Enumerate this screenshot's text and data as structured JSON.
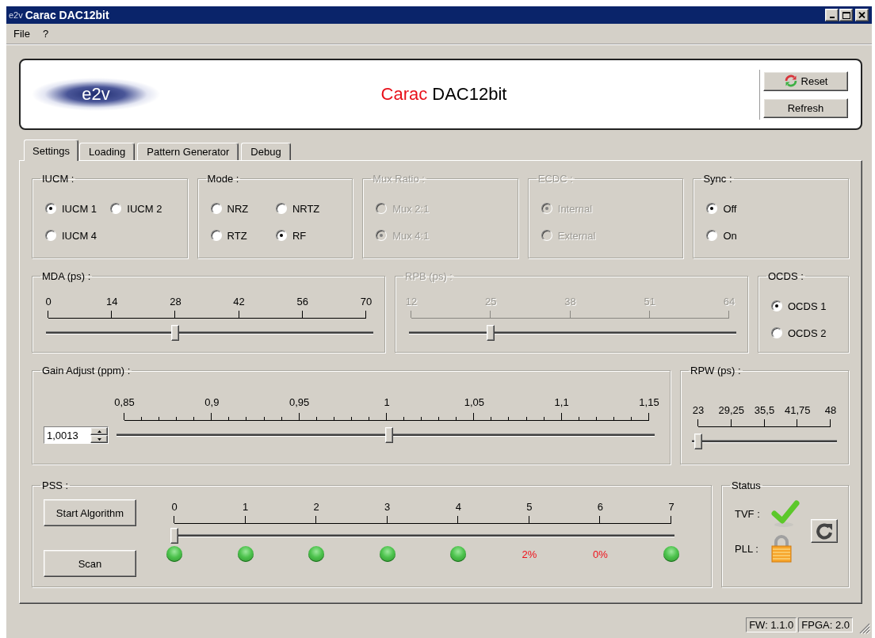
{
  "window": {
    "icon_label": "e2v",
    "title": "Carac DAC12bit"
  },
  "menu": [
    {
      "label": "File"
    },
    {
      "label": "?"
    }
  ],
  "header": {
    "logo": "e2v",
    "title_accent": "Carac",
    "title": "DAC12bit",
    "buttons": [
      {
        "label": "Reset",
        "kind": "reset"
      },
      {
        "label": "Refresh",
        "kind": "plain"
      }
    ]
  },
  "tabs": [
    {
      "label": "Settings",
      "selected": true
    },
    {
      "label": "Loading",
      "selected": false
    },
    {
      "label": "Pattern Generator",
      "selected": false
    },
    {
      "label": "Debug",
      "selected": false
    }
  ],
  "rows": [
    {
      "panels": [
        {
          "kind": "radios",
          "title": "IUCM :",
          "disabled": false,
          "options": [
            {
              "label": "IUCM 1",
              "selected": true
            },
            {
              "label": "IUCM 2",
              "selected": false
            },
            {
              "label": "IUCM 4",
              "selected": false
            }
          ]
        },
        {
          "kind": "radios",
          "title": "Mode :",
          "disabled": false,
          "options": [
            {
              "label": "NRZ",
              "selected": false
            },
            {
              "label": "NRTZ",
              "selected": false
            },
            {
              "label": "RTZ",
              "selected": false
            },
            {
              "label": "RF",
              "selected": true
            }
          ]
        },
        {
          "kind": "radios",
          "title": "Mux Ratio :",
          "disabled": true,
          "options": [
            {
              "label": "Mux 2:1",
              "selected": false
            },
            {
              "label": "Mux 4:1",
              "selected": true
            }
          ]
        },
        {
          "kind": "radios",
          "title": "ECDC :",
          "disabled": true,
          "options": [
            {
              "label": "Internal",
              "selected": true
            },
            {
              "label": "External",
              "selected": false
            }
          ]
        },
        {
          "kind": "radios",
          "title": "Sync :",
          "disabled": false,
          "options": [
            {
              "label": "Off",
              "selected": true
            },
            {
              "label": "On",
              "selected": false
            }
          ]
        }
      ]
    },
    {
      "panels": [
        {
          "kind": "slider",
          "title": "MDA (ps) :",
          "disabled": false,
          "ticks": [
            "0",
            "14",
            "28",
            "42",
            "56",
            "70"
          ],
          "level": 0.4
        },
        {
          "kind": "slider",
          "title": "RPB (ps) :",
          "disabled": true,
          "ticks": [
            "12",
            "25",
            "38",
            "51",
            "64"
          ],
          "level": 0.25
        },
        {
          "kind": "radios",
          "title": "OCDS :",
          "disabled": false,
          "options": [
            {
              "label": "OCDS 1",
              "selected": true
            },
            {
              "label": "OCDS 2",
              "selected": false
            }
          ]
        }
      ]
    },
    {
      "panels": [
        {
          "kind": "spinslider",
          "title": "Gain Adjust (ppm) :",
          "disabled": false,
          "ticks": [
            "0,85",
            "0,9",
            "0,95",
            "1",
            "1,05",
            "1,1",
            "1,15"
          ],
          "level": 0.504,
          "spin_value": "1,0013"
        },
        {
          "kind": "narrowslider",
          "title": "RPW (ps) :",
          "disabled": false,
          "ticks": [
            "23",
            "29,25",
            "35,5",
            "41,75",
            "48"
          ],
          "level": 0
        }
      ]
    },
    {
      "panels": [
        {
          "kind": "pss",
          "title": "PSS :",
          "buttons": [
            {
              "label": "Start Algorithm"
            },
            {
              "label": "Scan"
            }
          ],
          "ticks": [
            "0",
            "1",
            "2",
            "3",
            "4",
            "5",
            "6",
            "7"
          ],
          "level": 0,
          "indicators": [
            {
              "kind": "led"
            },
            {
              "kind": "led"
            },
            {
              "kind": "led"
            },
            {
              "kind": "led"
            },
            {
              "kind": "led"
            },
            {
              "kind": "percent",
              "text": "2%"
            },
            {
              "kind": "percent",
              "text": "0%"
            },
            {
              "kind": "led"
            }
          ]
        },
        {
          "kind": "status",
          "title": "Status",
          "items": [
            {
              "label": "TVF :",
              "kind": "check"
            },
            {
              "label": "PLL :",
              "kind": "lock"
            }
          ]
        }
      ]
    }
  ],
  "status_bar": [
    {
      "label": "FW: 1.1.0"
    },
    {
      "label": "FPGA: 2.0"
    }
  ]
}
